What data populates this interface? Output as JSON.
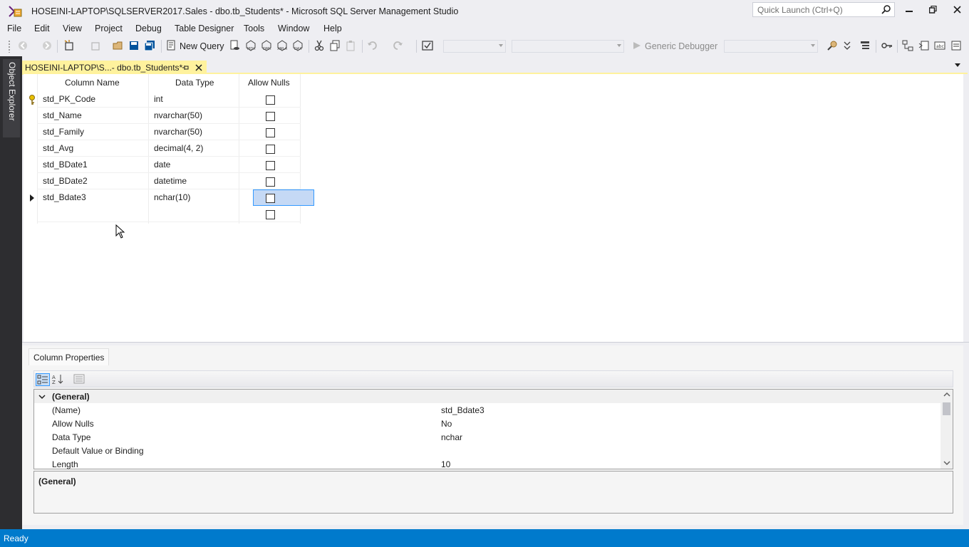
{
  "window": {
    "title": "HOSEINI-LAPTOP\\SQLSERVER2017.Sales - dbo.tb_Students* - Microsoft SQL Server Management Studio",
    "quick_launch_placeholder": "Quick Launch (Ctrl+Q)",
    "controls": [
      "minimize",
      "restore",
      "close"
    ]
  },
  "menu": [
    "File",
    "Edit",
    "View",
    "Project",
    "Debug",
    "Table Designer",
    "Tools",
    "Window",
    "Help"
  ],
  "toolbar": {
    "new_query_label": "New Query",
    "debugger_label": "Generic Debugger",
    "icons": [
      "back-icon",
      "forward-icon",
      "new-project-icon",
      "open-file-icon",
      "save-icon",
      "save-all-icon",
      "new-query-icon",
      "mdx-query-icon",
      "dmx-query-icon",
      "xmla-query-icon",
      "dax-query-icon",
      "cut-icon",
      "copy-icon",
      "paste-icon",
      "undo-icon",
      "redo-icon",
      "debug-icon",
      "find-icon",
      "solution-explorer-icon",
      "properties-icon",
      "primary-key-icon",
      "relationships-icon",
      "indexes-icon",
      "check-constraints-icon"
    ]
  },
  "side_panel": {
    "object_explorer_label": "Object Explorer"
  },
  "document_tab": {
    "title": "HOSEINI-LAPTOP\\S...- dbo.tb_Students*"
  },
  "designer": {
    "headers": {
      "column_name": "Column Name",
      "data_type": "Data Type",
      "allow_nulls": "Allow Nulls"
    },
    "rows": [
      {
        "name": "std_PK_Code",
        "type": "int",
        "allow_nulls": false,
        "marker": "primary-key"
      },
      {
        "name": "std_Name",
        "type": "nvarchar(50)",
        "allow_nulls": false,
        "marker": ""
      },
      {
        "name": "std_Family",
        "type": "nvarchar(50)",
        "allow_nulls": false,
        "marker": ""
      },
      {
        "name": "std_Avg",
        "type": "decimal(4, 2)",
        "allow_nulls": false,
        "marker": ""
      },
      {
        "name": "std_BDate1",
        "type": "date",
        "allow_nulls": false,
        "marker": ""
      },
      {
        "name": "std_BDate2",
        "type": "datetime",
        "allow_nulls": false,
        "marker": ""
      },
      {
        "name": "std_Bdate3",
        "type": "nchar(10)",
        "allow_nulls": false,
        "marker": "current"
      },
      {
        "name": "",
        "type": "",
        "allow_nulls": false,
        "marker": ""
      }
    ]
  },
  "column_properties": {
    "tab_label": "Column Properties",
    "category": "(General)",
    "properties": [
      {
        "name": "(Name)",
        "value": "std_Bdate3"
      },
      {
        "name": "Allow Nulls",
        "value": "No"
      },
      {
        "name": "Data Type",
        "value": "nchar"
      },
      {
        "name": "Default Value or Binding",
        "value": ""
      },
      {
        "name": "Length",
        "value": "10"
      }
    ],
    "description_title": "(General)"
  },
  "status": {
    "text": "Ready"
  },
  "colors": {
    "accent": "#007acc",
    "tab_active": "#fff29d",
    "selection": "#c5d9f5"
  }
}
